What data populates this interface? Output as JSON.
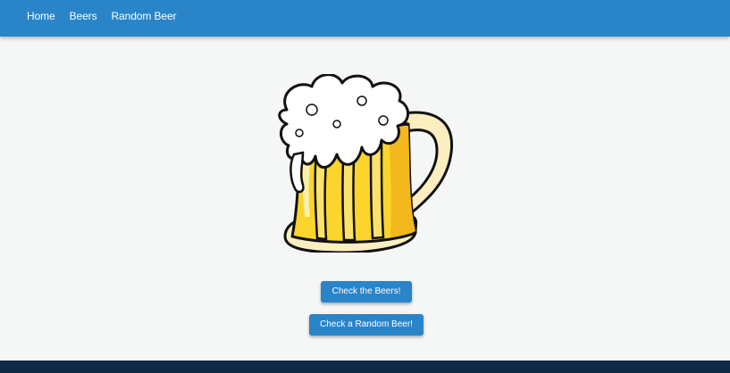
{
  "nav": {
    "items": [
      {
        "label": "Home"
      },
      {
        "label": "Beers"
      },
      {
        "label": "Random Beer"
      }
    ]
  },
  "main": {
    "image_icon": "beer-mug-icon",
    "buttons": {
      "beers_label": "Check the Beers!",
      "random_label": "Check a Random Beer!"
    }
  },
  "colors": {
    "navbar": "#2a84c8",
    "button": "#2a84c8",
    "background": "#f5f6f6",
    "footer": "#0e2a44",
    "beer": "#fbd52c",
    "foam": "#ffffff",
    "mug_base": "#fbeec1"
  }
}
